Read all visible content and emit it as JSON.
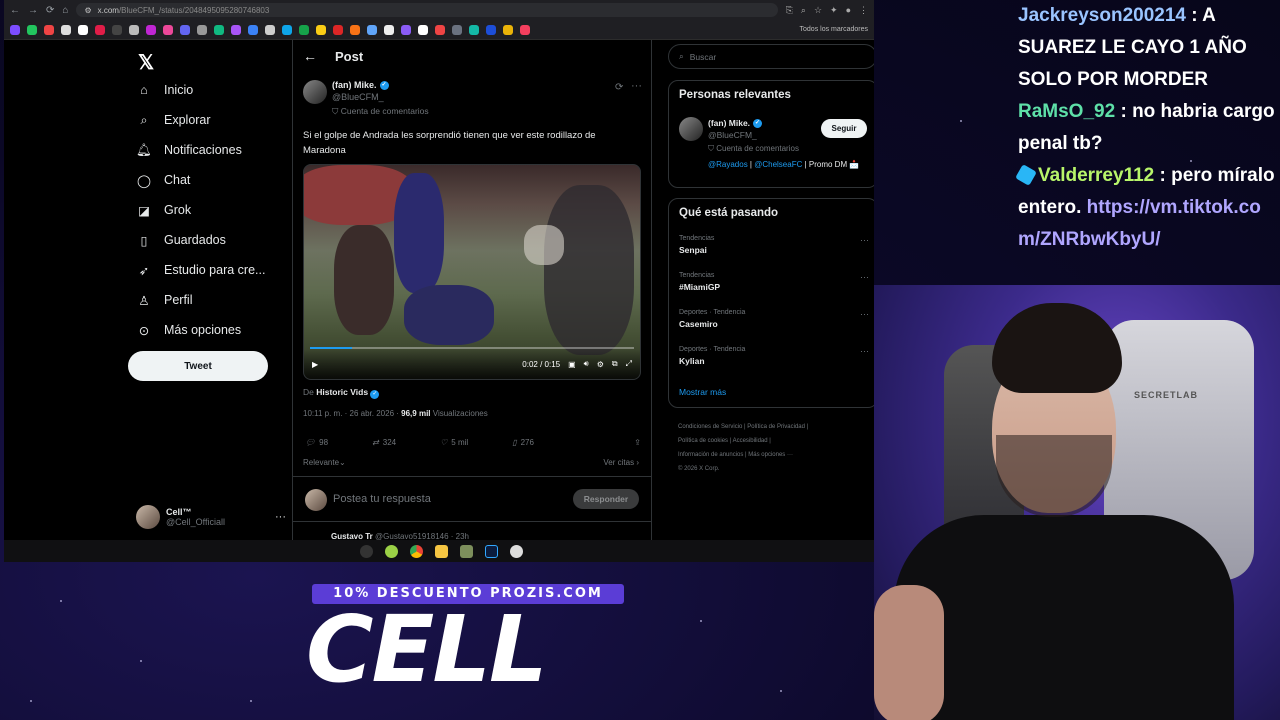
{
  "browser": {
    "url_main": "x.com",
    "url_path": "/BlueCFM_/status/2048495095280746803",
    "bookmarks_folder": "Todos los marcadores"
  },
  "x": {
    "nav": [
      {
        "label": "Inicio",
        "icon": "home-icon"
      },
      {
        "label": "Explorar",
        "icon": "search-icon"
      },
      {
        "label": "Notificaciones",
        "icon": "bell-icon"
      },
      {
        "label": "Chat",
        "icon": "chat-icon"
      },
      {
        "label": "Grok",
        "icon": "grok-icon"
      },
      {
        "label": "Guardados",
        "icon": "bookmark-icon"
      },
      {
        "label": "Estudio para cre...",
        "icon": "rocket-icon"
      },
      {
        "label": "Perfil",
        "icon": "user-icon"
      },
      {
        "label": "Más opciones",
        "icon": "more-icon"
      }
    ],
    "tweet_button": "Tweet",
    "account": {
      "name": "Cell™",
      "handle": "@Cell_Officiall"
    }
  },
  "post": {
    "header": "Post",
    "author_name": "(fan) Mike.",
    "author_handle": "@BlueCFM_",
    "author_sub": "Cuenta de comentarios",
    "text": "Si el golpe de Andrada les sorprendió tienen que ver este rodillazo de Maradona",
    "video_time": "0:02 / 0:15",
    "video_progress": 0.13,
    "from_prefix": "De",
    "from_source": "Historic Vids",
    "timestamp": "10:11 p. m. · 26 abr. 2026 ·",
    "views_count": "96,9 mil",
    "views_label": "Visualizaciones",
    "replies": "98",
    "reposts": "324",
    "likes": "5 mil",
    "bookmarks": "276",
    "sort": "Relevante",
    "quotes": "Ver citas",
    "reply_placeholder": "Postea tu respuesta",
    "reply_button": "Responder",
    "next_reply_name": "Gustavo Tr",
    "next_reply_handle": "@Gustavo51918146 · 23h"
  },
  "right": {
    "search_placeholder": "Buscar",
    "people_title": "Personas relevantes",
    "person_name": "(fan) Mike.",
    "person_handle": "@BlueCFM_",
    "person_sub": "Cuenta de comentarios",
    "person_bio_link1": "@Rayados",
    "person_bio_sep": " | ",
    "person_bio_link2": "@ChelseaFC",
    "person_bio_rest": " | Promo DM 📩",
    "follow_button": "Seguir",
    "trends_title": "Qué está pasando",
    "trends": [
      {
        "context": "Tendencias",
        "name": "Senpai"
      },
      {
        "context": "Tendencias",
        "name": "#MiamiGP"
      },
      {
        "context": "Deportes · Tendencia",
        "name": "Casemiro"
      },
      {
        "context": "Deportes · Tendencia",
        "name": "Kylian"
      }
    ],
    "show_more": "Mostrar más",
    "footer_line1": "Condiciones de Servicio  |  Política de Privacidad  |",
    "footer_line2": "Política de cookies  |  Accesibilidad  |",
    "footer_line3": "Información de anuncios  |  Más opciones ···",
    "footer_line4": "© 2026 X Corp."
  },
  "chat": [
    {
      "user": "Jackreyson200214",
      "sep": " : ",
      "msg": "A SUAREZ LE CAYO 1 AÑO SOLO POR MORDER"
    },
    {
      "user": "RaMsO_92",
      "sep": " : ",
      "msg": "no habria cargo penal tb?"
    },
    {
      "user": "Valderrey112",
      "sep": " : ",
      "msg": "pero míralo entero.",
      "link": "https://vm.tiktok.com/ZNRbwKbyU/"
    }
  ],
  "webcam": {
    "chair_brand": "SECRETLAB"
  },
  "overlay": {
    "promo": "10% DESCUENTO PROZIS.COM",
    "brand": "CELL"
  },
  "colors": {
    "accent": "#1d9bf0",
    "promo": "#5b3dd6",
    "background": "#000000"
  }
}
